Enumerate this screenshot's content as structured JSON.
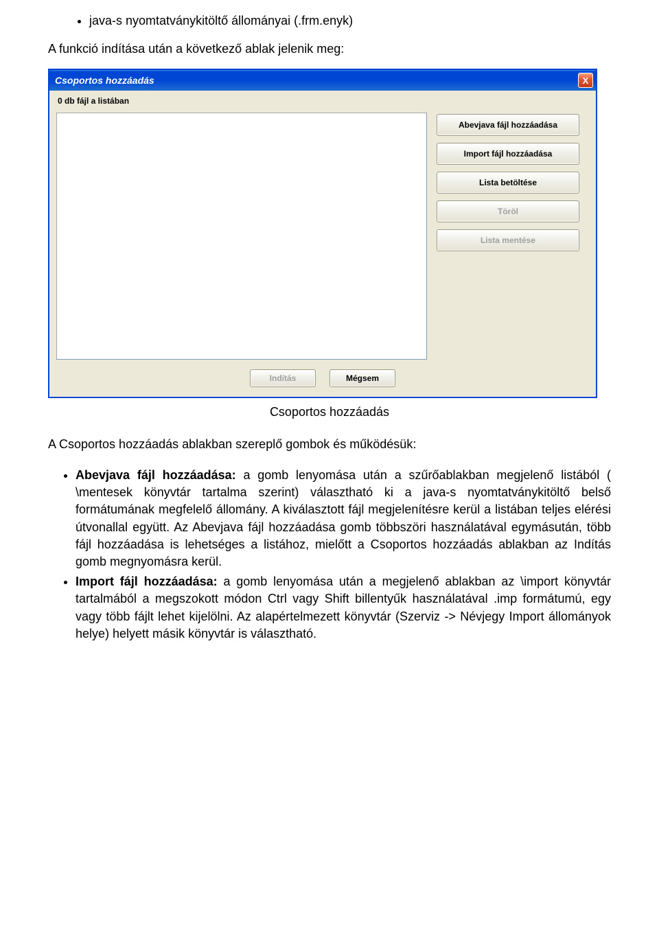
{
  "intro_bullet": "java-s nyomtatványkitöltő állományai (.frm.enyk)",
  "intro_line": "A funkció indítása után a következő ablak jelenik meg:",
  "dialog": {
    "title": "Csoportos hozzáadás",
    "close_glyph": "X",
    "count_label": "0 db fájl a listában",
    "buttons": {
      "add_abevjava": "Abevjava fájl hozzáadása",
      "add_import": "Import fájl hozzáadása",
      "load_list": "Lista betöltése",
      "delete": "Töröl",
      "save_list": "Lista mentése",
      "start": "Indítás",
      "cancel": "Mégsem"
    }
  },
  "caption": "Csoportos hozzáadás",
  "para_after": "A Csoportos hozzáadás ablakban szereplő gombok és működésük:",
  "desc": {
    "item1_bold": "Abevjava fájl hozzáadása: ",
    "item1_text": "a gomb lenyomása után a szűrőablakban megjelenő listából ( \\mentesek könyvtár tartalma szerint) választható ki a java-s nyomtatványkitöltő belső formátumának megfelelő állomány. A kiválasztott fájl megjelenítésre kerül a listában teljes elérési útvonallal együtt. Az Abevjava fájl hozzáadása gomb többszöri használatával egymásután, több fájl hozzáadása is lehetséges a listához, mielőtt a Csoportos hozzáadás ablakban az Indítás gomb megnyomásra kerül.",
    "item2_bold": "Import fájl hozzáadása: ",
    "item2_text": "a gomb lenyomása után a megjelenő ablakban az \\import könyvtár tartalmából a megszokott módon Ctrl vagy Shift billentyűk használatával .imp formátumú, egy vagy több fájlt lehet kijelölni. Az alapértelmezett könyvtár (Szerviz -> Névjegy Import állományok helye) helyett másik könyvtár is választható."
  }
}
